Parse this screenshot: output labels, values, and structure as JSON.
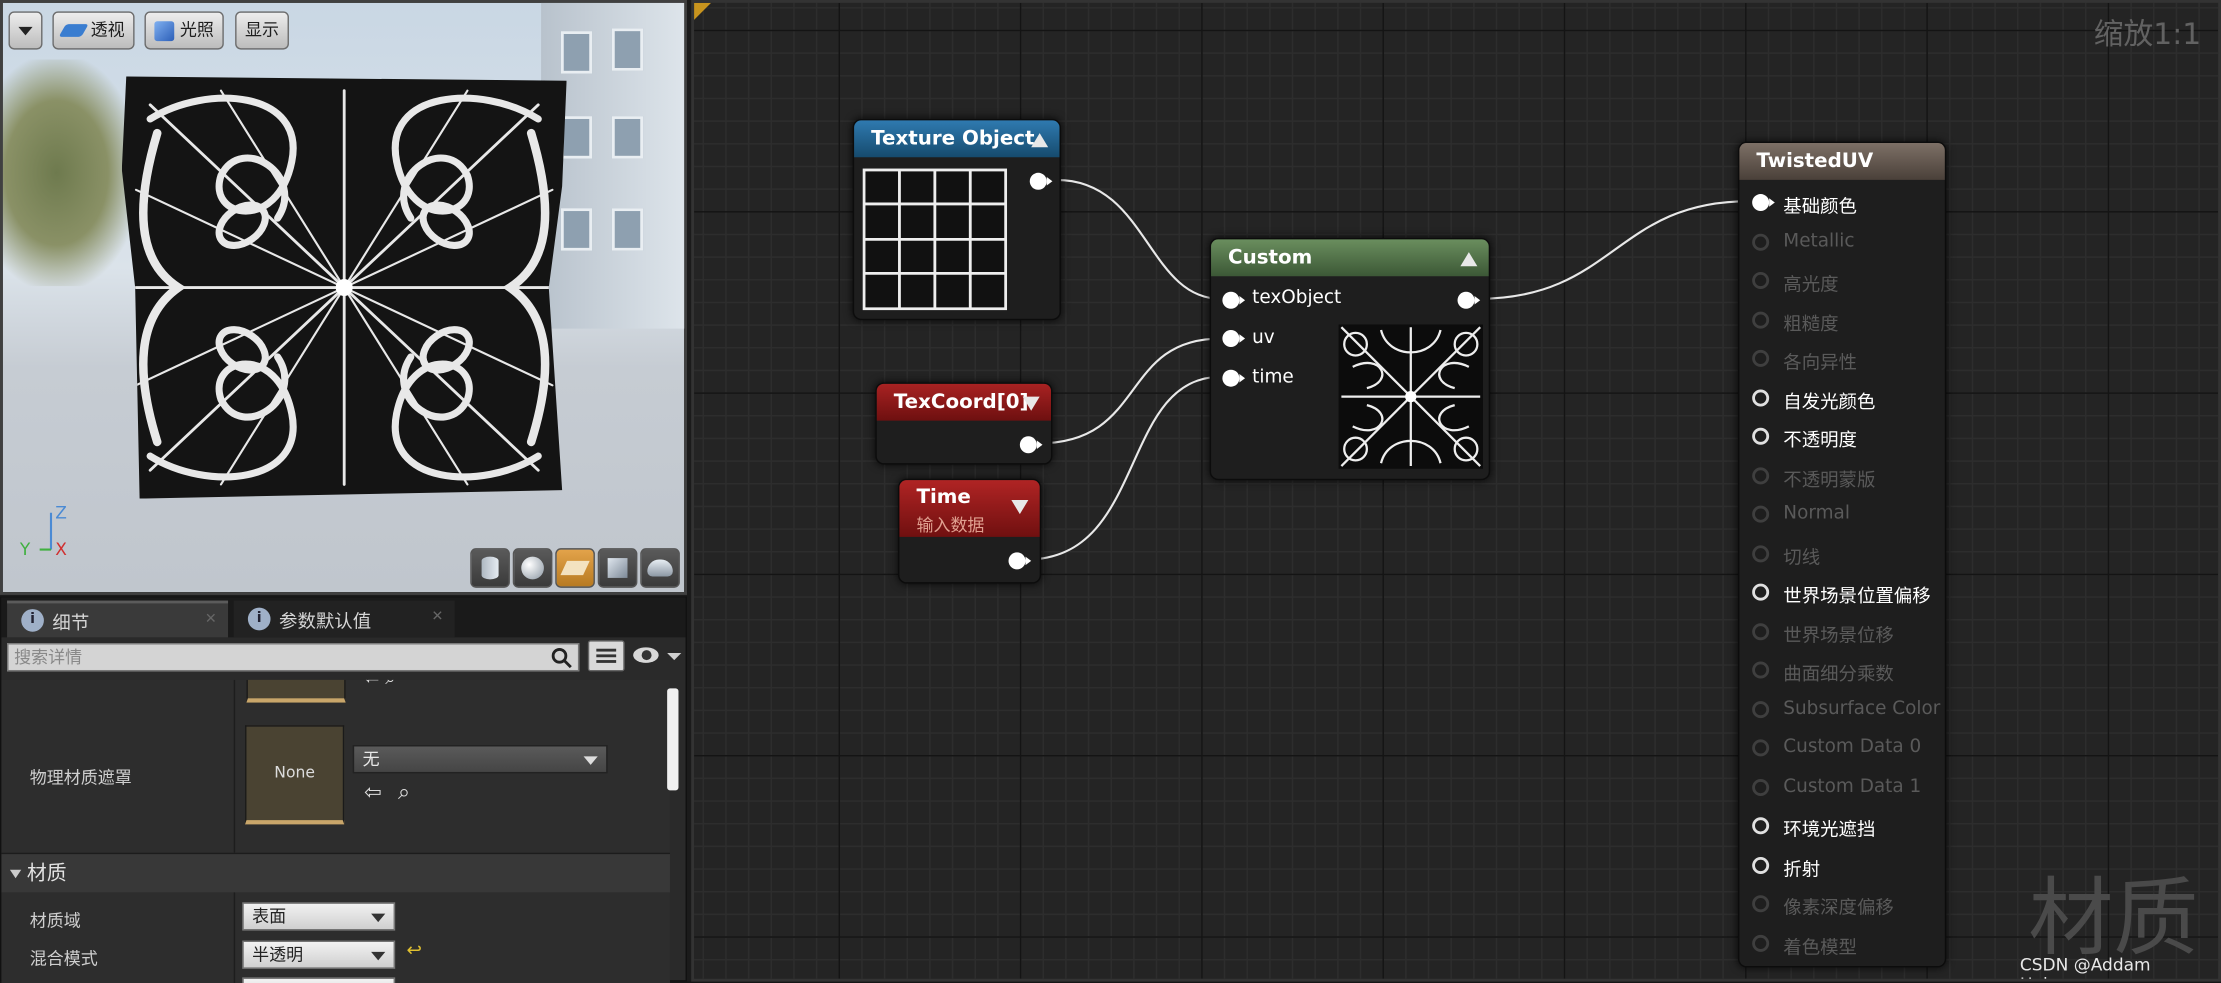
{
  "viewport": {
    "menu_icon": "chevron-down-icon",
    "perspective_label": "透视",
    "lit_label": "光照",
    "show_label": "显示",
    "axis": {
      "z": "Z",
      "y": "Y",
      "x": "X"
    },
    "preview_buttons": [
      "cylinder-icon",
      "sphere-icon",
      "plane-icon",
      "cube-icon",
      "teapot-icon"
    ],
    "active_preview": "plane-icon"
  },
  "details": {
    "tabs": [
      {
        "label": "细节"
      },
      {
        "label": "参数默认值"
      }
    ],
    "search_placeholder": "搜索详情",
    "phys_mask": {
      "label": "物理材质遮罩",
      "thumb_text": "None",
      "combo_value": "无"
    },
    "section_material": "材质",
    "material_domain": {
      "label": "材质域",
      "value": "表面"
    },
    "blend_mode": {
      "label": "混合模式",
      "value": "半透明"
    }
  },
  "graph": {
    "zoom_label": "缩放1:1",
    "watermark": "材质",
    "credit": "CSDN @Addam Holmes",
    "nodes": {
      "texture_object": {
        "title": "Texture Object",
        "color": "#1b5e86"
      },
      "texcoord": {
        "title": "TexCoord[0]",
        "color": "#8a1414"
      },
      "time": {
        "title": "Time",
        "subtitle": "输入数据",
        "color": "#8a1414"
      },
      "custom": {
        "title": "Custom",
        "color": "#4d6e45",
        "inputs": [
          "texObject",
          "uv",
          "time"
        ]
      },
      "result": {
        "title": "TwistedUV",
        "color": "#5a5048",
        "pins": [
          {
            "label": "基础颜色",
            "state": "connected"
          },
          {
            "label": "Metallic",
            "state": "disabled"
          },
          {
            "label": "高光度",
            "state": "disabled"
          },
          {
            "label": "粗糙度",
            "state": "disabled"
          },
          {
            "label": "各向异性",
            "state": "disabled"
          },
          {
            "label": "自发光颜色",
            "state": "enabled"
          },
          {
            "label": "不透明度",
            "state": "enabled"
          },
          {
            "label": "不透明蒙版",
            "state": "disabled"
          },
          {
            "label": "Normal",
            "state": "disabled"
          },
          {
            "label": "切线",
            "state": "disabled"
          },
          {
            "label": "世界场景位置偏移",
            "state": "enabled"
          },
          {
            "label": "世界场景位移",
            "state": "disabled"
          },
          {
            "label": "曲面细分乘数",
            "state": "disabled"
          },
          {
            "label": "Subsurface Color",
            "state": "disabled"
          },
          {
            "label": "Custom Data 0",
            "state": "disabled"
          },
          {
            "label": "Custom Data 1",
            "state": "disabled"
          },
          {
            "label": "环境光遮挡",
            "state": "enabled"
          },
          {
            "label": "折射",
            "state": "enabled"
          },
          {
            "label": "像素深度偏移",
            "state": "disabled"
          },
          {
            "label": "着色模型",
            "state": "disabled"
          }
        ]
      }
    }
  }
}
